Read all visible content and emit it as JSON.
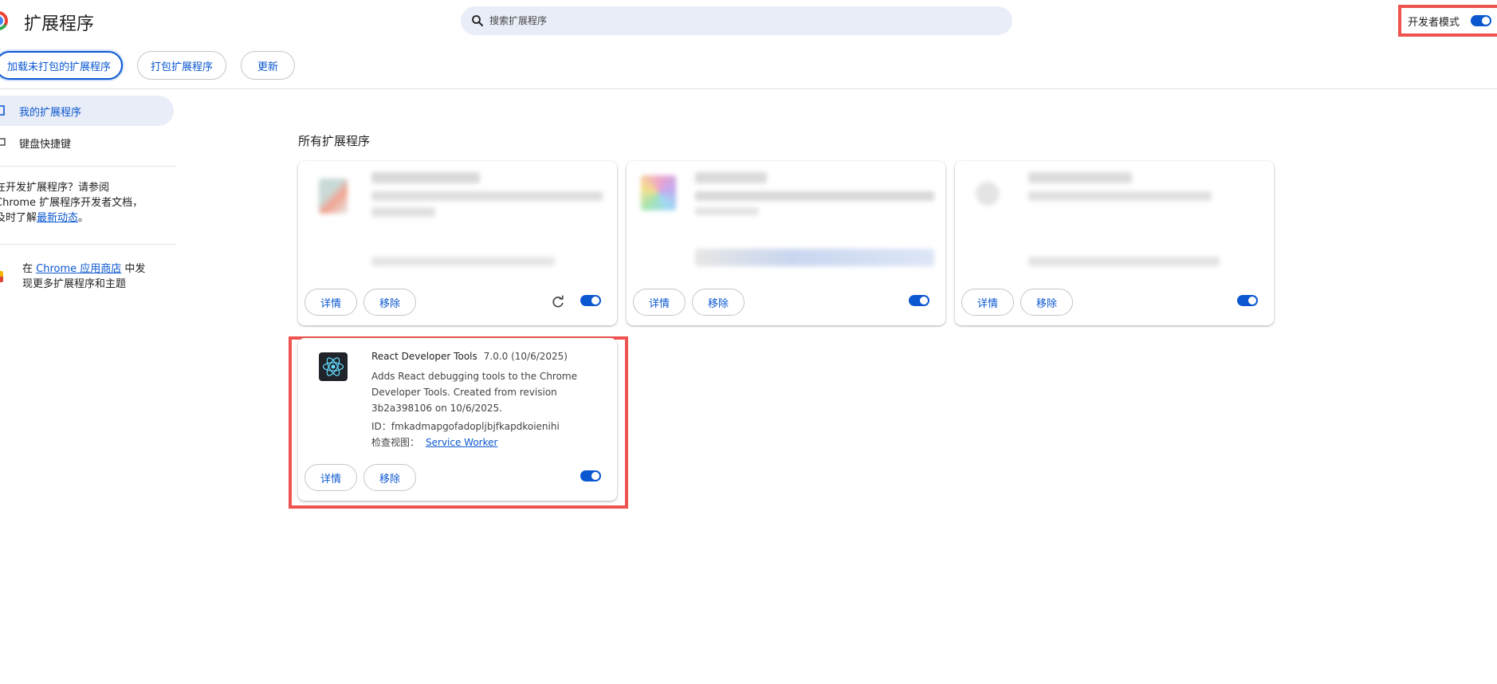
{
  "header": {
    "title": "扩展程序",
    "search_placeholder": "搜索扩展程序",
    "dev_mode_label": "开发者模式",
    "dev_mode_on": true
  },
  "toolbar": {
    "load_unpacked": "加载未打包的扩展程序",
    "pack": "打包扩展程序",
    "update": "更新"
  },
  "sidebar": {
    "items": [
      {
        "label": "我的扩展程序",
        "active": true
      },
      {
        "label": "键盘快捷键",
        "active": false
      }
    ],
    "dev_text_1": "在开发扩展程序？请参阅",
    "dev_text_2": "Chrome 扩展程序开发者文档，",
    "dev_text_3": "及时了解",
    "dev_link": "最新动态",
    "dev_text_end": "。",
    "store_prefix": "在",
    "store_link": "Chrome 应用商店",
    "store_suffix": "中发",
    "store_text_2": "现更多扩展程序和主题"
  },
  "main": {
    "section_title": "所有扩展程序",
    "card_buttons": {
      "details": "详情",
      "remove": "移除"
    },
    "highlighted_extension": {
      "name": "React Developer Tools",
      "version": "7.0.0 (10/6/2025)",
      "description": "Adds React debugging tools to the Chrome Developer Tools. Created from revision 3b2a398106 on 10/6/2025.",
      "id_label": "ID：",
      "id": "fmkadmapgofadopljbjfkapdkoienihi",
      "inspect_label": "检查视图：",
      "inspect_link": "Service Worker",
      "enabled": true
    }
  },
  "colors": {
    "accent": "#0b57d0",
    "highlight": "#ef5350"
  }
}
